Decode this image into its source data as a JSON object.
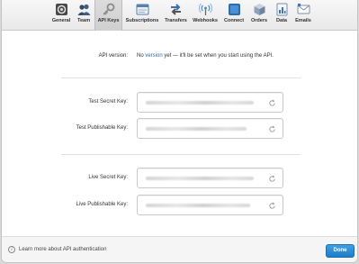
{
  "toolbar": {
    "items": [
      {
        "label": "General",
        "icon": "general-icon"
      },
      {
        "label": "Team",
        "icon": "team-icon"
      },
      {
        "label": "API Keys",
        "icon": "key-icon",
        "active": true
      },
      {
        "label": "Subscriptions",
        "icon": "subscriptions-icon"
      },
      {
        "label": "Transfers",
        "icon": "transfers-icon"
      },
      {
        "label": "Webhooks",
        "icon": "webhooks-icon"
      },
      {
        "label": "Connect",
        "icon": "connect-icon"
      },
      {
        "label": "Orders",
        "icon": "orders-icon"
      },
      {
        "label": "Data",
        "icon": "data-icon"
      },
      {
        "label": "Emails",
        "icon": "emails-icon"
      }
    ]
  },
  "api_version": {
    "label": "API version:",
    "prefix": "No",
    "link": "version",
    "suffix": "yet — it'll be set when you start using the API."
  },
  "test_keys": {
    "secret_label": "Test Secret Key:",
    "publishable_label": "Test Publishable Key:"
  },
  "live_keys": {
    "secret_label": "Live Secret Key:",
    "publishable_label": "Live Publishable Key:"
  },
  "footer": {
    "info_glyph": "i",
    "learn_more": "Learn more about API authentication",
    "done_label": "Done"
  },
  "colors": {
    "accent": "#1f7cc7",
    "link": "#2b6cb6"
  }
}
